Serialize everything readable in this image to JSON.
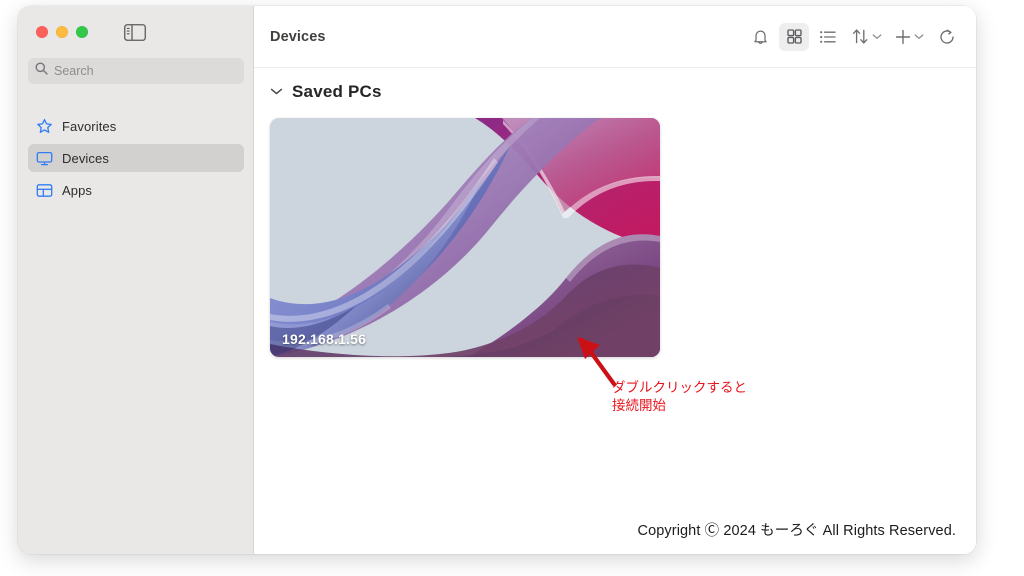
{
  "window": {
    "traffic_lights": [
      {
        "name": "close",
        "color": "#fc615d"
      },
      {
        "name": "minimize",
        "color": "#fdbc40"
      },
      {
        "name": "maximize",
        "color": "#34c84a"
      }
    ],
    "sidebar_toggle_icon": "sidebar-toggle-icon"
  },
  "sidebar": {
    "search": {
      "placeholder": "Search",
      "value": "",
      "icon": "search-icon"
    },
    "items": [
      {
        "label": "Favorites",
        "icon": "star-icon",
        "selected": false
      },
      {
        "label": "Devices",
        "icon": "monitor-icon",
        "selected": true
      },
      {
        "label": "Apps",
        "icon": "apps-grid-icon",
        "selected": false
      }
    ],
    "accent_color": "#2f7cf6",
    "background_color": "#e9e8e6",
    "selected_row_color": "#d2d1cf"
  },
  "toolbar": {
    "title": "Devices",
    "actions": [
      {
        "name": "notifications-button",
        "icon": "bell-icon",
        "active": false,
        "has_chevron": false
      },
      {
        "name": "grid-view-button",
        "icon": "grid-view-icon",
        "active": true,
        "has_chevron": false
      },
      {
        "name": "list-view-button",
        "icon": "list-view-icon",
        "active": false,
        "has_chevron": false
      },
      {
        "name": "sort-button",
        "icon": "sort-arrows-icon",
        "active": false,
        "has_chevron": true
      },
      {
        "name": "add-button",
        "icon": "plus-icon",
        "active": false,
        "has_chevron": true
      },
      {
        "name": "refresh-button",
        "icon": "refresh-icon",
        "active": false,
        "has_chevron": false
      }
    ]
  },
  "main": {
    "section": {
      "title": "Saved PCs",
      "disclosure_icon": "chevron-down-icon",
      "expanded": true
    },
    "devices": [
      {
        "label": "192.168.1.56",
        "thumbnail": "windows-11-abstract-wallpaper"
      }
    ]
  },
  "annotation": {
    "text": "ダブルクリックすると\n接続開始",
    "color": "#e8141c",
    "arrow_icon": "arrow-up-left-icon"
  },
  "footer": {
    "text": "Copyright Ⓒ 2024 もーろぐ All Rights Reserved."
  }
}
